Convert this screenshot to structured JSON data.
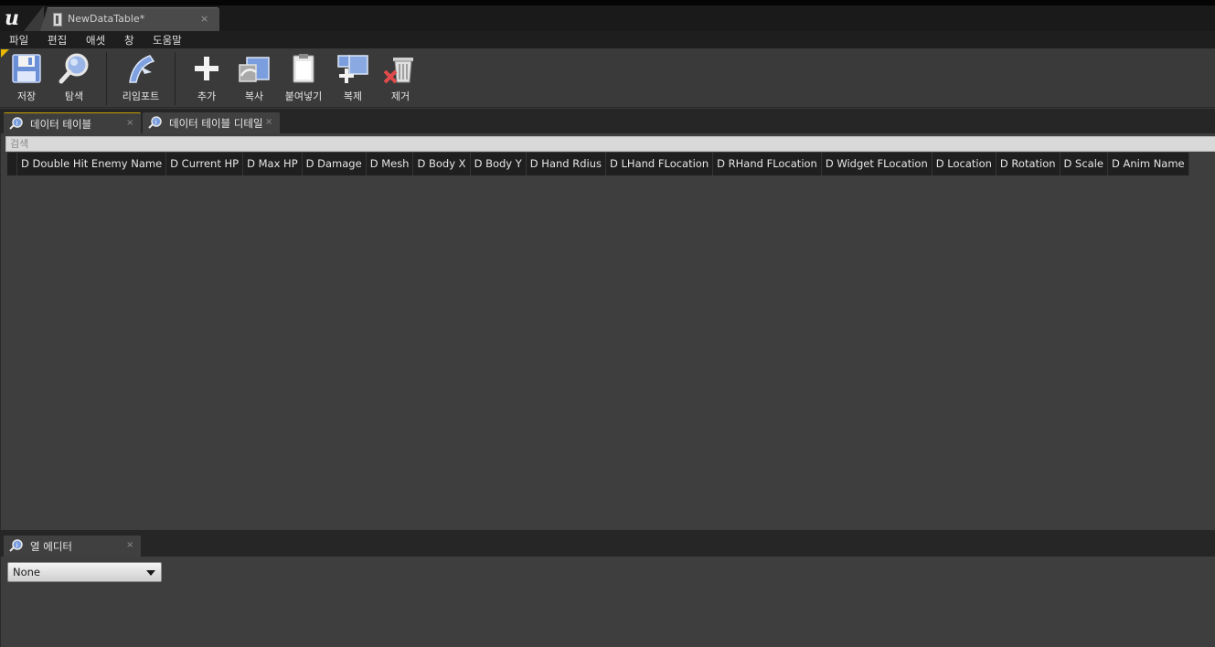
{
  "document_tab": {
    "title": "NewDataTable*",
    "close": "×"
  },
  "menu": [
    "파일",
    "편집",
    "애셋",
    "창",
    "도움말"
  ],
  "toolbar": {
    "save_label": "저장",
    "browse_label": "탐색",
    "reimport_label": "리임포트",
    "add_label": "추가",
    "copy_label": "복사",
    "paste_label": "붙여넣기",
    "duplicate_label": "복제",
    "remove_label": "제거"
  },
  "data_table_tabs": [
    {
      "label": "데이터 테이블",
      "close": "×"
    },
    {
      "label": "데이터 테이블 디테일",
      "close": "×"
    }
  ],
  "search": {
    "placeholder": "검색",
    "value": ""
  },
  "columns": [
    "D Double Hit Enemy Name",
    "D Current HP",
    "D Max HP",
    "D Damage",
    "D Mesh",
    "D Body X",
    "D Body Y",
    "D Hand Rdius",
    "D LHand FLocation",
    "D RHand FLocation",
    "D Widget FLocation",
    "D Location",
    "D Rotation",
    "D Scale",
    "D Anim Name"
  ],
  "column_editor": {
    "tab_label": "열 에디터",
    "close": "×",
    "row_select_value": "None"
  },
  "colors": {
    "background": "#3a3a3a",
    "menubar": "#1e1e1e",
    "header_bg": "#1f1f1f",
    "active_tab_accent": "#c8a000",
    "dirty_marker": "#e8b800"
  }
}
